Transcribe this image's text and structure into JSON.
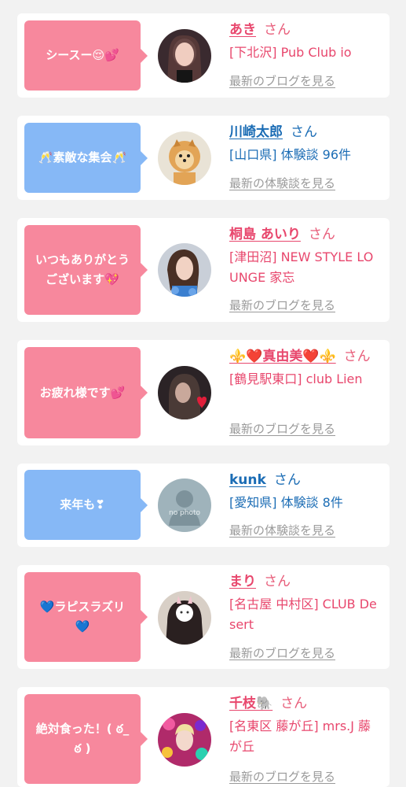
{
  "entries": [
    {
      "message": "シースー😌💕",
      "name": "あき",
      "honorific": "さん",
      "shop": "[下北沢] Pub Club io",
      "link": "最新のブログを見る",
      "avatar_icon": "woman-photo-icon"
    },
    {
      "message": "🥂素敵な集会🥂",
      "name": "川崎太郎",
      "honorific": "さん",
      "shop": "[山口県] 体験談 96件",
      "link": "最新の体験談を見る",
      "avatar_icon": "pomeranian-photo-icon"
    },
    {
      "message": "いつもありがとうございます💖",
      "name": "桐島 あいり",
      "honorific": "さん",
      "shop": "[津田沼] NEW STYLE LOUNGE 家忘",
      "link": "最新のブログを見る",
      "avatar_icon": "woman-photo-icon"
    },
    {
      "message": "お疲れ様です💕",
      "name": "⚜️❤️真由美❤️⚜️",
      "honorific": "さん",
      "shop": "[鶴見駅東口] club Lien",
      "link": "最新のブログを見る",
      "avatar_icon": "woman-photo-icon"
    },
    {
      "message": "来年も❣",
      "name": "kunk",
      "honorific": "さん",
      "shop": "[愛知県] 体験談 8件",
      "link": "最新の体験談を見る",
      "avatar_icon": "no-photo-placeholder-icon",
      "avatar_text": "no photo"
    },
    {
      "message": "💙ラピスラズリ💙",
      "name": "まり",
      "honorific": "さん",
      "shop": "[名古屋 中村区] CLUB Desert",
      "link": "最新のブログを見る",
      "avatar_icon": "woman-photo-icon"
    },
    {
      "message": "絶対食った！( ఠ_ఠ )",
      "name": "千枝🐘",
      "honorific": "さん",
      "shop": "[名東区 藤が丘] mrs.J 藤が丘",
      "link": "最新のブログを見る",
      "avatar_icon": "woman-photo-icon"
    }
  ],
  "colors": {
    "pink_bubble": "#f7889d",
    "blue_bubble": "#86b8f6",
    "pink_text": "#e8476d",
    "blue_text": "#1c6db5",
    "link_gray": "#9a9a9a",
    "background": "#f2f2f2"
  }
}
